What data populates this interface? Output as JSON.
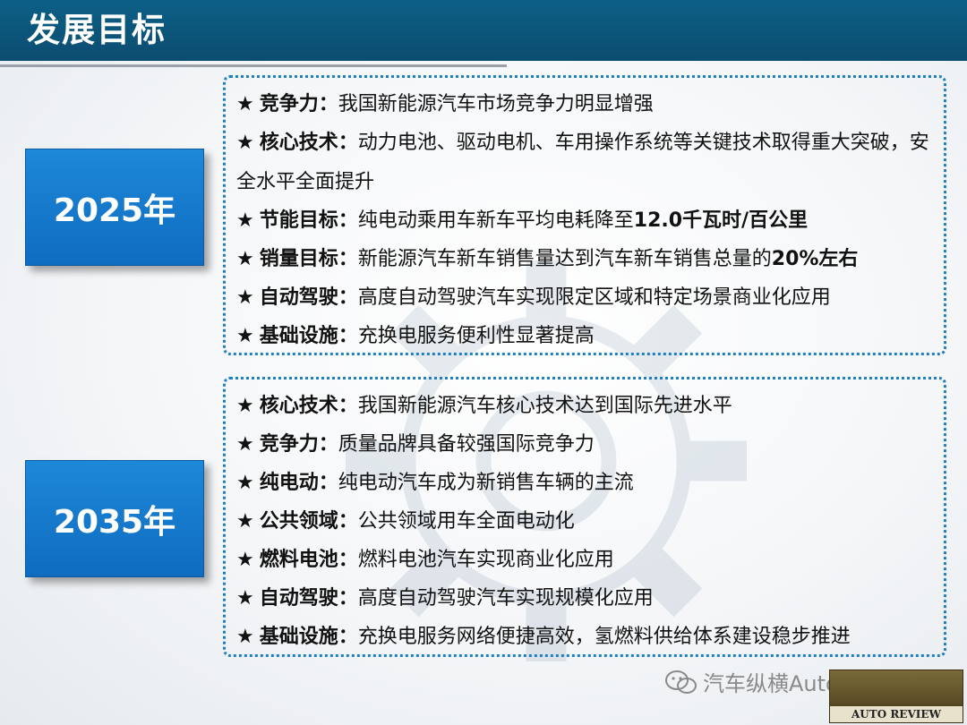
{
  "header": {
    "title": "发展目标"
  },
  "years": {
    "y2025": "2025年",
    "y2035": "2035年"
  },
  "goals_2025": [
    {
      "star": "★",
      "key": "竞争力：",
      "text": "我国新能源汽车市场竞争力明显增强",
      "bold": ""
    },
    {
      "star": "★",
      "key": "核心技术：",
      "text": "动力电池、驱动电机、车用操作系统等关键技术取得重大突破，安全水平全面提升",
      "bold": ""
    },
    {
      "star": "★",
      "key": "节能目标：",
      "text": "纯电动乘用车新车平均电耗降至",
      "bold": "12.0千瓦时/百公里"
    },
    {
      "star": "★",
      "key": "销量目标：",
      "text": "新能源汽车新车销售量达到汽车新车销售总量的",
      "bold": "20%左右"
    },
    {
      "star": "★",
      "key": "自动驾驶：",
      "text": "高度自动驾驶汽车实现限定区域和特定场景商业化应用",
      "bold": ""
    },
    {
      "star": "★",
      "key": "基础设施：",
      "text": "充换电服务便利性显著提高",
      "bold": ""
    }
  ],
  "goals_2035": [
    {
      "star": "★",
      "key": "核心技术：",
      "text": "我国新能源汽车核心技术达到国际先进水平"
    },
    {
      "star": "★",
      "key": "竞争力：",
      "text": "质量品牌具备较强国际竞争力"
    },
    {
      "star": "★",
      "key": "纯电动：",
      "text": "纯电动汽车成为新销售车辆的主流"
    },
    {
      "star": "★",
      "key": "公共领域：",
      "text": "公共领域用车全面电动化"
    },
    {
      "star": "★",
      "key": "燃料电池：",
      "text": "燃料电池汽车实现商业化应用"
    },
    {
      "star": "★",
      "key": "自动驾驶：",
      "text": "高度自动驾驶汽车实现规模化应用"
    },
    {
      "star": "★",
      "key": "基础设施：",
      "text": "充换电服务网络便捷高效，氢燃料供给体系建设稳步推进"
    }
  ],
  "footer": {
    "wechat_icon": "wechat-icon",
    "watermark_text": "汽车纵横AutoReview",
    "logo_text": "AUTO REVIEW"
  },
  "colors": {
    "header_bg": "#0b4d70",
    "year_box": "#1576c8",
    "panel_border": "#1f7fc0"
  }
}
